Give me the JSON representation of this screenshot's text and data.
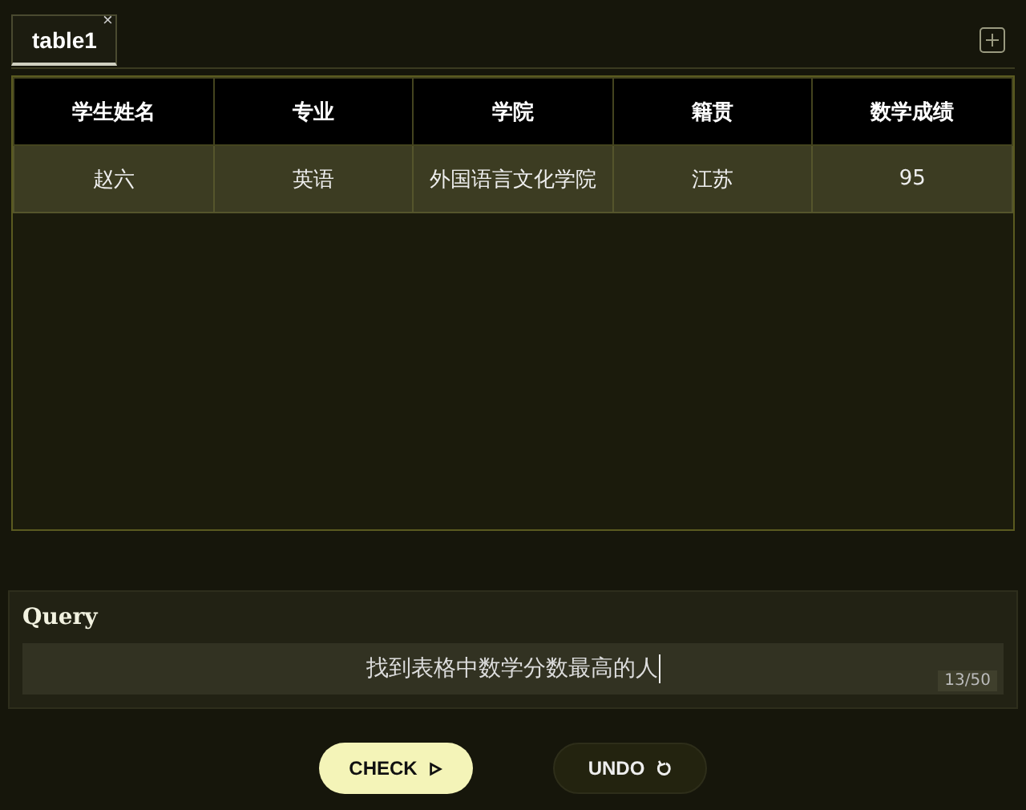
{
  "tabs": [
    {
      "label": "table1",
      "selected": true,
      "close": "×"
    }
  ],
  "table": {
    "columns": [
      "学生姓名",
      "专业",
      "学院",
      "籍贯",
      "数学成绩"
    ],
    "rows": [
      [
        "赵六",
        "英语",
        "外国语言文化学院",
        "江苏",
        "95"
      ]
    ]
  },
  "query": {
    "label": "Query",
    "value": "找到表格中数学分数最高的人",
    "counter": "13/50"
  },
  "buttons": [
    {
      "label": "CHECK",
      "kind": "check"
    },
    {
      "label": "UNDO",
      "kind": "undo"
    }
  ]
}
